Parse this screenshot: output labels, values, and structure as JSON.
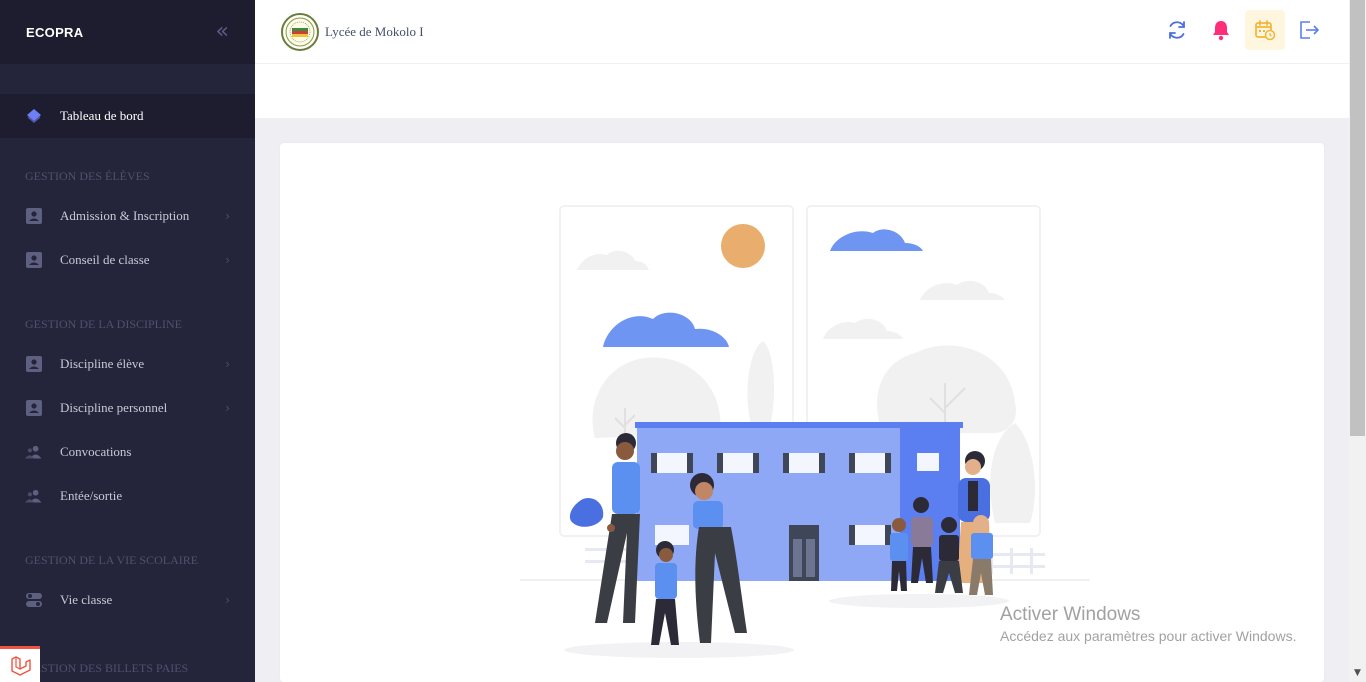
{
  "sidebar": {
    "brand": "ECOPRA",
    "collapse_icon": "«",
    "dashboard": {
      "label": "Tableau de bord",
      "icon": "diamond-icon"
    },
    "sections": [
      {
        "title": "GESTION DES ÉLÈVES",
        "items": [
          {
            "label": "Admission & Inscription",
            "icon": "id-card-icon",
            "has_children": true
          },
          {
            "label": "Conseil de classe",
            "icon": "id-card-icon",
            "has_children": true
          }
        ]
      },
      {
        "title": "GESTION DE LA DISCIPLINE",
        "items": [
          {
            "label": "Discipline élève",
            "icon": "id-card-icon",
            "has_children": true
          },
          {
            "label": "Discipline personnel",
            "icon": "id-card-icon",
            "has_children": true
          },
          {
            "label": "Convocations",
            "icon": "users-icon",
            "has_children": false
          },
          {
            "label": "Entée/sortie",
            "icon": "users-icon",
            "has_children": false
          }
        ]
      },
      {
        "title": "GESTION DE LA VIE SCOLAIRE",
        "items": [
          {
            "label": "Vie classe",
            "icon": "toggle-icon",
            "has_children": true
          }
        ]
      },
      {
        "title": "GESTION DES BILLETS PAIES",
        "items": []
      }
    ],
    "chevron": "›"
  },
  "header": {
    "school_name": "Lycée de Mokolo I",
    "icons": [
      "refresh-icon",
      "bell-icon",
      "calendar-icon",
      "logout-icon"
    ]
  },
  "watermark": {
    "title": "Activer Windows",
    "subtitle": "Accédez aux paramètres pour activer Windows."
  },
  "colors": {
    "sidebar_bg": "#24243a",
    "accent_blue": "#5b7ff0",
    "bell_pink": "#ff2e7a",
    "calendar_bg": "#fff6e0"
  }
}
